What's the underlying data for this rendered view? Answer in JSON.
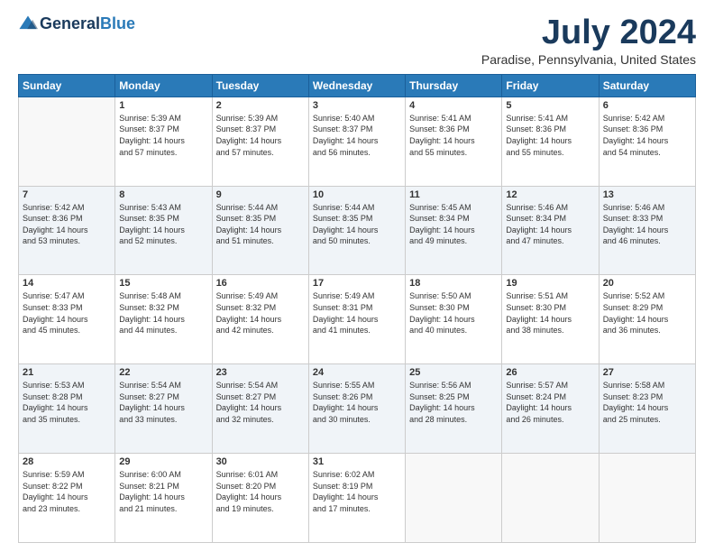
{
  "logo": {
    "line1": "General",
    "line2": "Blue"
  },
  "title": "July 2024",
  "location": "Paradise, Pennsylvania, United States",
  "days_header": [
    "Sunday",
    "Monday",
    "Tuesday",
    "Wednesday",
    "Thursday",
    "Friday",
    "Saturday"
  ],
  "weeks": [
    [
      {
        "num": "",
        "info": ""
      },
      {
        "num": "1",
        "info": "Sunrise: 5:39 AM\nSunset: 8:37 PM\nDaylight: 14 hours\nand 57 minutes."
      },
      {
        "num": "2",
        "info": "Sunrise: 5:39 AM\nSunset: 8:37 PM\nDaylight: 14 hours\nand 57 minutes."
      },
      {
        "num": "3",
        "info": "Sunrise: 5:40 AM\nSunset: 8:37 PM\nDaylight: 14 hours\nand 56 minutes."
      },
      {
        "num": "4",
        "info": "Sunrise: 5:41 AM\nSunset: 8:36 PM\nDaylight: 14 hours\nand 55 minutes."
      },
      {
        "num": "5",
        "info": "Sunrise: 5:41 AM\nSunset: 8:36 PM\nDaylight: 14 hours\nand 55 minutes."
      },
      {
        "num": "6",
        "info": "Sunrise: 5:42 AM\nSunset: 8:36 PM\nDaylight: 14 hours\nand 54 minutes."
      }
    ],
    [
      {
        "num": "7",
        "info": "Sunrise: 5:42 AM\nSunset: 8:36 PM\nDaylight: 14 hours\nand 53 minutes."
      },
      {
        "num": "8",
        "info": "Sunrise: 5:43 AM\nSunset: 8:35 PM\nDaylight: 14 hours\nand 52 minutes."
      },
      {
        "num": "9",
        "info": "Sunrise: 5:44 AM\nSunset: 8:35 PM\nDaylight: 14 hours\nand 51 minutes."
      },
      {
        "num": "10",
        "info": "Sunrise: 5:44 AM\nSunset: 8:35 PM\nDaylight: 14 hours\nand 50 minutes."
      },
      {
        "num": "11",
        "info": "Sunrise: 5:45 AM\nSunset: 8:34 PM\nDaylight: 14 hours\nand 49 minutes."
      },
      {
        "num": "12",
        "info": "Sunrise: 5:46 AM\nSunset: 8:34 PM\nDaylight: 14 hours\nand 47 minutes."
      },
      {
        "num": "13",
        "info": "Sunrise: 5:46 AM\nSunset: 8:33 PM\nDaylight: 14 hours\nand 46 minutes."
      }
    ],
    [
      {
        "num": "14",
        "info": "Sunrise: 5:47 AM\nSunset: 8:33 PM\nDaylight: 14 hours\nand 45 minutes."
      },
      {
        "num": "15",
        "info": "Sunrise: 5:48 AM\nSunset: 8:32 PM\nDaylight: 14 hours\nand 44 minutes."
      },
      {
        "num": "16",
        "info": "Sunrise: 5:49 AM\nSunset: 8:32 PM\nDaylight: 14 hours\nand 42 minutes."
      },
      {
        "num": "17",
        "info": "Sunrise: 5:49 AM\nSunset: 8:31 PM\nDaylight: 14 hours\nand 41 minutes."
      },
      {
        "num": "18",
        "info": "Sunrise: 5:50 AM\nSunset: 8:30 PM\nDaylight: 14 hours\nand 40 minutes."
      },
      {
        "num": "19",
        "info": "Sunrise: 5:51 AM\nSunset: 8:30 PM\nDaylight: 14 hours\nand 38 minutes."
      },
      {
        "num": "20",
        "info": "Sunrise: 5:52 AM\nSunset: 8:29 PM\nDaylight: 14 hours\nand 36 minutes."
      }
    ],
    [
      {
        "num": "21",
        "info": "Sunrise: 5:53 AM\nSunset: 8:28 PM\nDaylight: 14 hours\nand 35 minutes."
      },
      {
        "num": "22",
        "info": "Sunrise: 5:54 AM\nSunset: 8:27 PM\nDaylight: 14 hours\nand 33 minutes."
      },
      {
        "num": "23",
        "info": "Sunrise: 5:54 AM\nSunset: 8:27 PM\nDaylight: 14 hours\nand 32 minutes."
      },
      {
        "num": "24",
        "info": "Sunrise: 5:55 AM\nSunset: 8:26 PM\nDaylight: 14 hours\nand 30 minutes."
      },
      {
        "num": "25",
        "info": "Sunrise: 5:56 AM\nSunset: 8:25 PM\nDaylight: 14 hours\nand 28 minutes."
      },
      {
        "num": "26",
        "info": "Sunrise: 5:57 AM\nSunset: 8:24 PM\nDaylight: 14 hours\nand 26 minutes."
      },
      {
        "num": "27",
        "info": "Sunrise: 5:58 AM\nSunset: 8:23 PM\nDaylight: 14 hours\nand 25 minutes."
      }
    ],
    [
      {
        "num": "28",
        "info": "Sunrise: 5:59 AM\nSunset: 8:22 PM\nDaylight: 14 hours\nand 23 minutes."
      },
      {
        "num": "29",
        "info": "Sunrise: 6:00 AM\nSunset: 8:21 PM\nDaylight: 14 hours\nand 21 minutes."
      },
      {
        "num": "30",
        "info": "Sunrise: 6:01 AM\nSunset: 8:20 PM\nDaylight: 14 hours\nand 19 minutes."
      },
      {
        "num": "31",
        "info": "Sunrise: 6:02 AM\nSunset: 8:19 PM\nDaylight: 14 hours\nand 17 minutes."
      },
      {
        "num": "",
        "info": ""
      },
      {
        "num": "",
        "info": ""
      },
      {
        "num": "",
        "info": ""
      }
    ]
  ]
}
